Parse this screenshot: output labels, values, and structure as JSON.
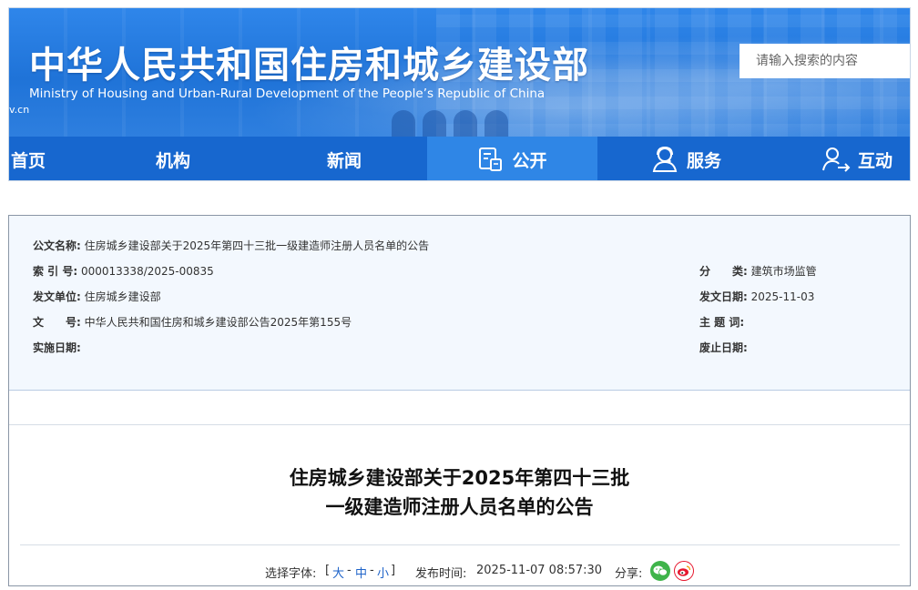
{
  "header": {
    "title": "中华人民共和国住房和城乡建设部",
    "subtitle": "Ministry of Housing and Urban-Rural Development of the People’s Republic of China",
    "domain_fragment": "v.cn",
    "search_placeholder": "请输入搜索的内容"
  },
  "nav": {
    "items": [
      {
        "label": "首页",
        "icon": "none",
        "active": false
      },
      {
        "label": "机构",
        "icon": "none",
        "active": false
      },
      {
        "label": "新闻",
        "icon": "none",
        "active": false
      },
      {
        "label": "公开",
        "icon": "document-icon",
        "active": true
      },
      {
        "label": "服务",
        "icon": "service-person-icon",
        "active": false
      },
      {
        "label": "互动",
        "icon": "interact-person-icon",
        "active": false
      }
    ]
  },
  "meta": {
    "doc_name_label": "公文名称:",
    "doc_name": "住房城乡建设部关于2025年第四十三批一级建造师注册人员名单的公告",
    "index_label": "索 引 号:",
    "index": "000013338/2025-00835",
    "category_label": "分　　类:",
    "category": "建筑市场监管",
    "issuer_label": "发文单位:",
    "issuer": "住房城乡建设部",
    "issue_date_label": "发文日期:",
    "issue_date": "2025-11-03",
    "doc_no_label": "文　　号:",
    "doc_no": "中华人民共和国住房和城乡建设部公告2025年第155号",
    "keywords_label": "主 题 词:",
    "keywords": "",
    "effective_label": "实施日期:",
    "effective": "",
    "abolish_label": "废止日期:",
    "abolish": ""
  },
  "article": {
    "title_line1": "住房城乡建设部关于2025年第四十三批",
    "title_line2": "一级建造师注册人员名单的公告",
    "font_label": "选择字体:",
    "bracket_open": "[",
    "font_large": "大",
    "font_medium": "中",
    "font_small": "小",
    "bracket_close": "]",
    "sep": "-",
    "publish_label": "发布时间:",
    "publish_time": "2025-11-07 08:57:30",
    "share_label": "分享:"
  },
  "colors": {
    "nav_bg": "#1767cf",
    "nav_active": "#2f86e6",
    "link": "#1e63c9",
    "wechat": "#3fb44a",
    "weibo": "#e6162d"
  }
}
